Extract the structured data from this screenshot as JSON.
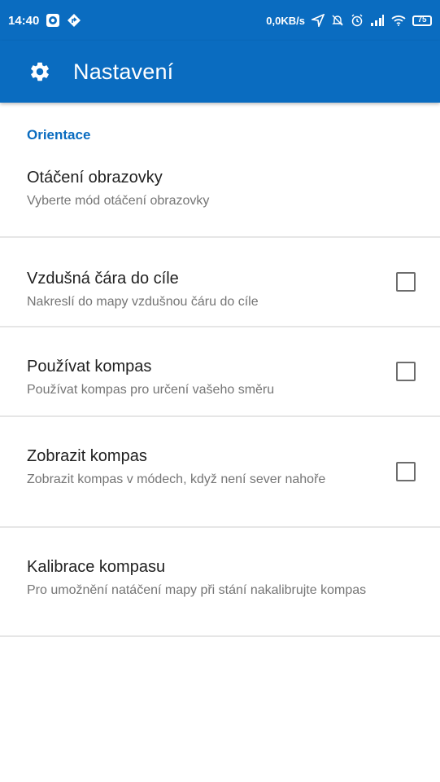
{
  "status_bar": {
    "time": "14:40",
    "net_speed": "0,0KB/s",
    "battery": "75",
    "icons": [
      "app-notification-icon",
      "navigation-icon",
      "location-icon",
      "mute-icon",
      "alarm-icon",
      "signal-icon",
      "wifi-icon",
      "battery-icon"
    ]
  },
  "app_bar": {
    "title": "Nastavení",
    "icon": "gear-icon"
  },
  "category": "Orientace",
  "prefs": [
    {
      "title": "Otáčení obrazovky",
      "summary": "Vyberte mód otáčení obrazovky",
      "has_checkbox": false
    },
    {
      "title": "Vzdušná čára do cíle",
      "summary": "Nakreslí do mapy vzdušnou čáru do cíle",
      "has_checkbox": true,
      "checked": false
    },
    {
      "title": "Používat kompas",
      "summary": "Používat kompas pro určení vašeho směru",
      "has_checkbox": true,
      "checked": false
    },
    {
      "title": "Zobrazit kompas",
      "summary": "Zobrazit kompas v módech, když není sever nahoře",
      "has_checkbox": true,
      "checked": false
    },
    {
      "title": "Kalibrace kompasu",
      "summary": "Pro umožnění natáčení mapy při stání nakalibrujte kompas",
      "has_checkbox": false
    }
  ],
  "colors": {
    "primary": "#0a6cc0",
    "divider": "#e6e6e6",
    "summary": "#757575"
  }
}
